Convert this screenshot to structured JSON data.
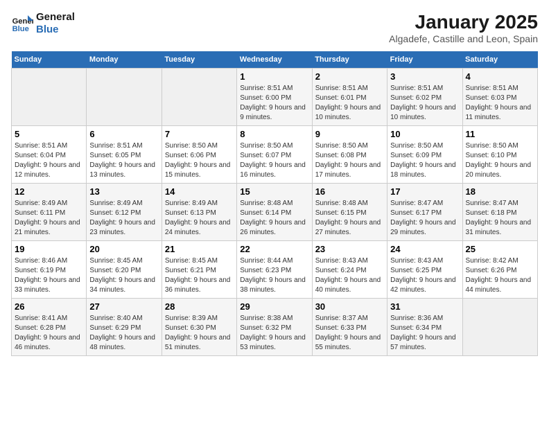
{
  "logo": {
    "line1": "General",
    "line2": "Blue"
  },
  "title": "January 2025",
  "subtitle": "Algadefe, Castille and Leon, Spain",
  "weekdays": [
    "Sunday",
    "Monday",
    "Tuesday",
    "Wednesday",
    "Thursday",
    "Friday",
    "Saturday"
  ],
  "weeks": [
    [
      {
        "day": "",
        "info": ""
      },
      {
        "day": "",
        "info": ""
      },
      {
        "day": "",
        "info": ""
      },
      {
        "day": "1",
        "info": "Sunrise: 8:51 AM\nSunset: 6:00 PM\nDaylight: 9 hours and 9 minutes."
      },
      {
        "day": "2",
        "info": "Sunrise: 8:51 AM\nSunset: 6:01 PM\nDaylight: 9 hours and 10 minutes."
      },
      {
        "day": "3",
        "info": "Sunrise: 8:51 AM\nSunset: 6:02 PM\nDaylight: 9 hours and 10 minutes."
      },
      {
        "day": "4",
        "info": "Sunrise: 8:51 AM\nSunset: 6:03 PM\nDaylight: 9 hours and 11 minutes."
      }
    ],
    [
      {
        "day": "5",
        "info": "Sunrise: 8:51 AM\nSunset: 6:04 PM\nDaylight: 9 hours and 12 minutes."
      },
      {
        "day": "6",
        "info": "Sunrise: 8:51 AM\nSunset: 6:05 PM\nDaylight: 9 hours and 13 minutes."
      },
      {
        "day": "7",
        "info": "Sunrise: 8:50 AM\nSunset: 6:06 PM\nDaylight: 9 hours and 15 minutes."
      },
      {
        "day": "8",
        "info": "Sunrise: 8:50 AM\nSunset: 6:07 PM\nDaylight: 9 hours and 16 minutes."
      },
      {
        "day": "9",
        "info": "Sunrise: 8:50 AM\nSunset: 6:08 PM\nDaylight: 9 hours and 17 minutes."
      },
      {
        "day": "10",
        "info": "Sunrise: 8:50 AM\nSunset: 6:09 PM\nDaylight: 9 hours and 18 minutes."
      },
      {
        "day": "11",
        "info": "Sunrise: 8:50 AM\nSunset: 6:10 PM\nDaylight: 9 hours and 20 minutes."
      }
    ],
    [
      {
        "day": "12",
        "info": "Sunrise: 8:49 AM\nSunset: 6:11 PM\nDaylight: 9 hours and 21 minutes."
      },
      {
        "day": "13",
        "info": "Sunrise: 8:49 AM\nSunset: 6:12 PM\nDaylight: 9 hours and 23 minutes."
      },
      {
        "day": "14",
        "info": "Sunrise: 8:49 AM\nSunset: 6:13 PM\nDaylight: 9 hours and 24 minutes."
      },
      {
        "day": "15",
        "info": "Sunrise: 8:48 AM\nSunset: 6:14 PM\nDaylight: 9 hours and 26 minutes."
      },
      {
        "day": "16",
        "info": "Sunrise: 8:48 AM\nSunset: 6:15 PM\nDaylight: 9 hours and 27 minutes."
      },
      {
        "day": "17",
        "info": "Sunrise: 8:47 AM\nSunset: 6:17 PM\nDaylight: 9 hours and 29 minutes."
      },
      {
        "day": "18",
        "info": "Sunrise: 8:47 AM\nSunset: 6:18 PM\nDaylight: 9 hours and 31 minutes."
      }
    ],
    [
      {
        "day": "19",
        "info": "Sunrise: 8:46 AM\nSunset: 6:19 PM\nDaylight: 9 hours and 33 minutes."
      },
      {
        "day": "20",
        "info": "Sunrise: 8:45 AM\nSunset: 6:20 PM\nDaylight: 9 hours and 34 minutes."
      },
      {
        "day": "21",
        "info": "Sunrise: 8:45 AM\nSunset: 6:21 PM\nDaylight: 9 hours and 36 minutes."
      },
      {
        "day": "22",
        "info": "Sunrise: 8:44 AM\nSunset: 6:23 PM\nDaylight: 9 hours and 38 minutes."
      },
      {
        "day": "23",
        "info": "Sunrise: 8:43 AM\nSunset: 6:24 PM\nDaylight: 9 hours and 40 minutes."
      },
      {
        "day": "24",
        "info": "Sunrise: 8:43 AM\nSunset: 6:25 PM\nDaylight: 9 hours and 42 minutes."
      },
      {
        "day": "25",
        "info": "Sunrise: 8:42 AM\nSunset: 6:26 PM\nDaylight: 9 hours and 44 minutes."
      }
    ],
    [
      {
        "day": "26",
        "info": "Sunrise: 8:41 AM\nSunset: 6:28 PM\nDaylight: 9 hours and 46 minutes."
      },
      {
        "day": "27",
        "info": "Sunrise: 8:40 AM\nSunset: 6:29 PM\nDaylight: 9 hours and 48 minutes."
      },
      {
        "day": "28",
        "info": "Sunrise: 8:39 AM\nSunset: 6:30 PM\nDaylight: 9 hours and 51 minutes."
      },
      {
        "day": "29",
        "info": "Sunrise: 8:38 AM\nSunset: 6:32 PM\nDaylight: 9 hours and 53 minutes."
      },
      {
        "day": "30",
        "info": "Sunrise: 8:37 AM\nSunset: 6:33 PM\nDaylight: 9 hours and 55 minutes."
      },
      {
        "day": "31",
        "info": "Sunrise: 8:36 AM\nSunset: 6:34 PM\nDaylight: 9 hours and 57 minutes."
      },
      {
        "day": "",
        "info": ""
      }
    ]
  ]
}
